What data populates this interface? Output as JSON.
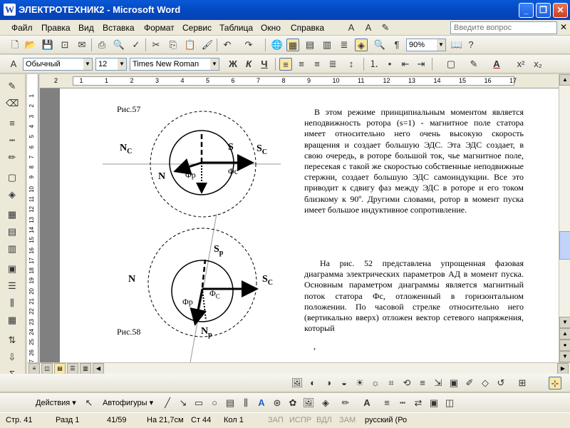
{
  "window": {
    "title": "ЭЛЕКТРОТЕХНИК2 - Microsoft Word",
    "app_icon": "W"
  },
  "menu": {
    "items": [
      "Файл",
      "Правка",
      "Вид",
      "Вставка",
      "Формат",
      "Сервис",
      "Таблица",
      "Окно",
      "Справка"
    ],
    "ask_placeholder": "Введите вопрос"
  },
  "toolbar": {
    "zoom": "90%"
  },
  "format": {
    "style": "Обычный",
    "size": "12",
    "font": "Times New Roman",
    "bold": "Ж",
    "italic": "К",
    "underline": "Ч"
  },
  "ruler": {
    "marks": [
      "2",
      "1",
      "1",
      "2",
      "3",
      "4",
      "5",
      "6",
      "7",
      "8",
      "9",
      "10",
      "11",
      "12",
      "13",
      "14",
      "15",
      "16",
      "17"
    ]
  },
  "vruler": {
    "marks": [
      "1",
      "2",
      "3",
      "4",
      "5",
      "6",
      "7",
      "8",
      "9",
      "10",
      "11",
      "12",
      "13",
      "14",
      "15",
      "16",
      "17",
      "18",
      "19",
      "20",
      "21",
      "22",
      "23",
      "24",
      "25",
      "26",
      "27"
    ]
  },
  "document": {
    "fig57": {
      "caption": "Рис.57",
      "NC": "N",
      "NC_sub": "C",
      "N": "N",
      "S": "S",
      "SC": "S",
      "SC_sub": "C",
      "Fp": "Φр",
      "Fc": "Φс"
    },
    "fig58": {
      "caption": "Рис.58",
      "N": "N",
      "SC": "S",
      "SC_sub": "C",
      "Sp": "S",
      "Sp_sub": "р",
      "Np": "N",
      "Np_sub": "р",
      "Fp": "Φр",
      "Fc": "Φ",
      "Fc_sub": "С"
    },
    "para1": "В этом режиме принципиальным моментом является неподвижность ротора (s=1) - магнитное поле статора имеет относительно него очень высокую скорость вращения и создает большую ЭДС. Эта ЭДС создает, в свою очередь, в роторе большой ток, чье магнитное поле, пересекая с такой же скоростью собственные неподвижные стержни, создает большую ЭДС самоиндукции. Все это приводит к сдвигу фаз между ЭДС в роторе и его током близкому к 90º. Другими словами, ротор в момент пуска имеет большое индуктивное сопротивление.",
    "para2": "На рис. 52 представлена упрощенная фазовая диаграмма электрических параметров АД в момент пуска. Основным параметром диаграммы является магнитный поток статора Фс, отложенный в горизонтальном положении. По часовой стрелке относительно него (вертикально вверх) отложен вектор сетевого напряжения, который",
    "trail": ","
  },
  "drawing": {
    "actions": "Действия ▾",
    "autoshapes": "Автофигуры ▾"
  },
  "status": {
    "page": "Стр.  41",
    "section": "Разд  1",
    "pages": "41/59",
    "at": "На 21,7см",
    "line": "Ст  44",
    "col": "Кол  1",
    "rec": "ЗАП",
    "trk": "ИСПР",
    "ext": "ВДЛ",
    "ovr": "ЗАМ",
    "lang": "русский (Ро"
  },
  "colors": {
    "titlebar": "#0a58d6",
    "face": "#ece9d8",
    "highlight_toggle": "#fce6a4"
  }
}
